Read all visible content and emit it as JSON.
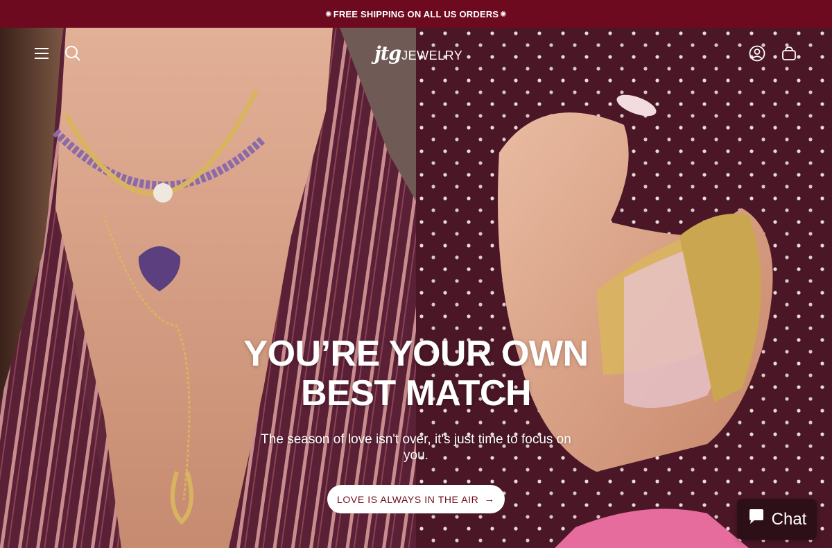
{
  "announcement": {
    "text": "FREE SHIPPING ON ALL US ORDERS",
    "decoration": "✺"
  },
  "header": {
    "logo_mark": "jtg",
    "logo_word": "JEWELRY",
    "icons": [
      "menu-icon",
      "search-icon",
      "account-icon",
      "cart-icon"
    ]
  },
  "hero": {
    "title": "YOU’RE YOUR OWN BEST MATCH",
    "subtitle": "The season of love isn't over, it's just time to focus on you.",
    "cta_label": "LOVE IS ALWAYS IN THE AIR",
    "cta_icon": "arrow-right-icon"
  },
  "chat": {
    "label": "Chat",
    "icon": "chat-bubble-icon"
  },
  "colors": {
    "brand": "#6e0a1f",
    "chat_bg": "#2d0f18",
    "text_light": "#ffffff"
  }
}
